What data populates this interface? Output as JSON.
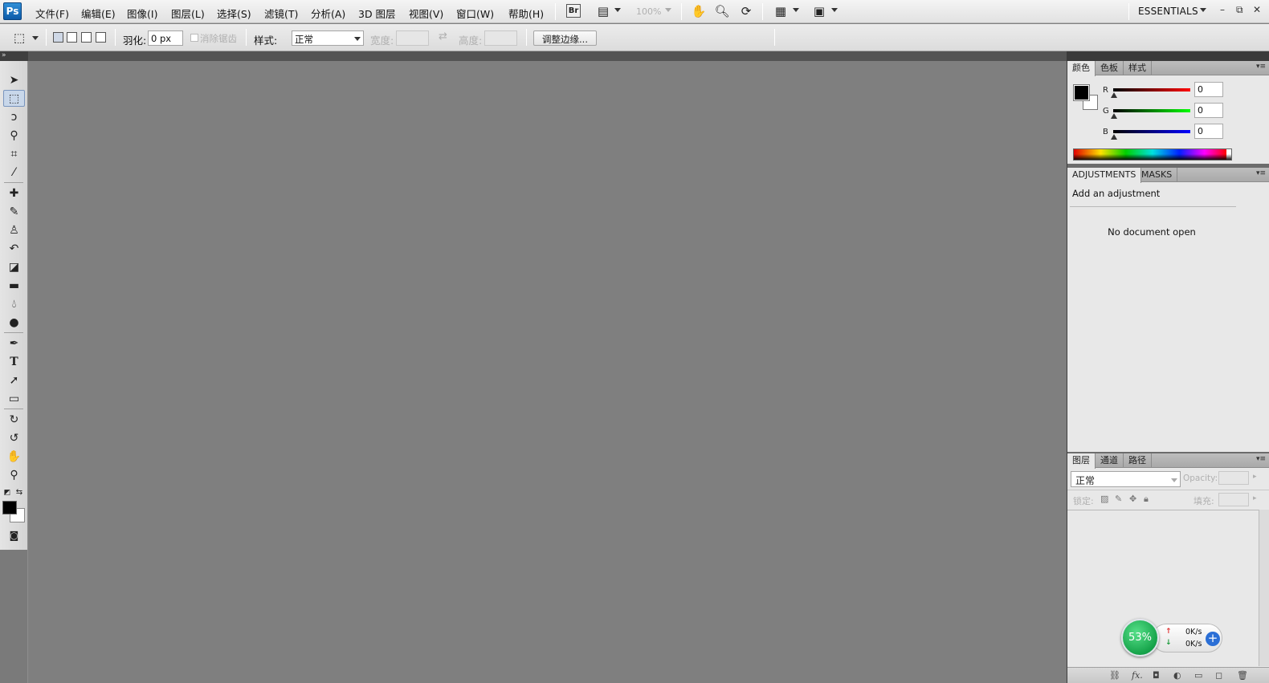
{
  "app": {
    "logo": "Ps",
    "workspace": "ESSENTIALS"
  },
  "menu": [
    {
      "id": "file",
      "label": "文件(F)"
    },
    {
      "id": "edit",
      "label": "编辑(E)"
    },
    {
      "id": "image",
      "label": "图像(I)"
    },
    {
      "id": "layer",
      "label": "图层(L)"
    },
    {
      "id": "select",
      "label": "选择(S)"
    },
    {
      "id": "filter",
      "label": "滤镜(T)"
    },
    {
      "id": "analysis",
      "label": "分析(A)"
    },
    {
      "id": "threed",
      "label": "3D 图层"
    },
    {
      "id": "view",
      "label": "视图(V)"
    },
    {
      "id": "window",
      "label": "窗口(W)"
    },
    {
      "id": "help",
      "label": "帮助(H)"
    }
  ],
  "appbar": {
    "bridge_label": "Br",
    "zoom_level": "100%"
  },
  "options": {
    "feather_label": "羽化:",
    "feather_value": "0 px",
    "antialias_label": "消除锯齿",
    "style_label": "样式:",
    "style_value": "正常",
    "width_label": "宽度:",
    "height_label": "高度:",
    "refine_edge_label": "调整边缘..."
  },
  "color_panel": {
    "tabs": [
      "颜色",
      "色板",
      "样式"
    ],
    "r": "0",
    "g": "0",
    "b": "0",
    "r_label": "R",
    "g_label": "G",
    "b_label": "B",
    "fg_color": "#000000",
    "bg_color": "#ffffff"
  },
  "adjustments_panel": {
    "tabs": [
      "ADJUSTMENTS",
      "MASKS"
    ],
    "title": "Add an adjustment",
    "empty_message": "No document open"
  },
  "layers_panel": {
    "tabs": [
      "图层",
      "通道",
      "路径"
    ],
    "blend_mode": "正常",
    "opacity_label": "Opacity:",
    "lock_label": "锁定:",
    "fill_label": "填充:"
  },
  "net_widget": {
    "percent": "53%",
    "upload": "0K/s",
    "download": "0K/s"
  }
}
